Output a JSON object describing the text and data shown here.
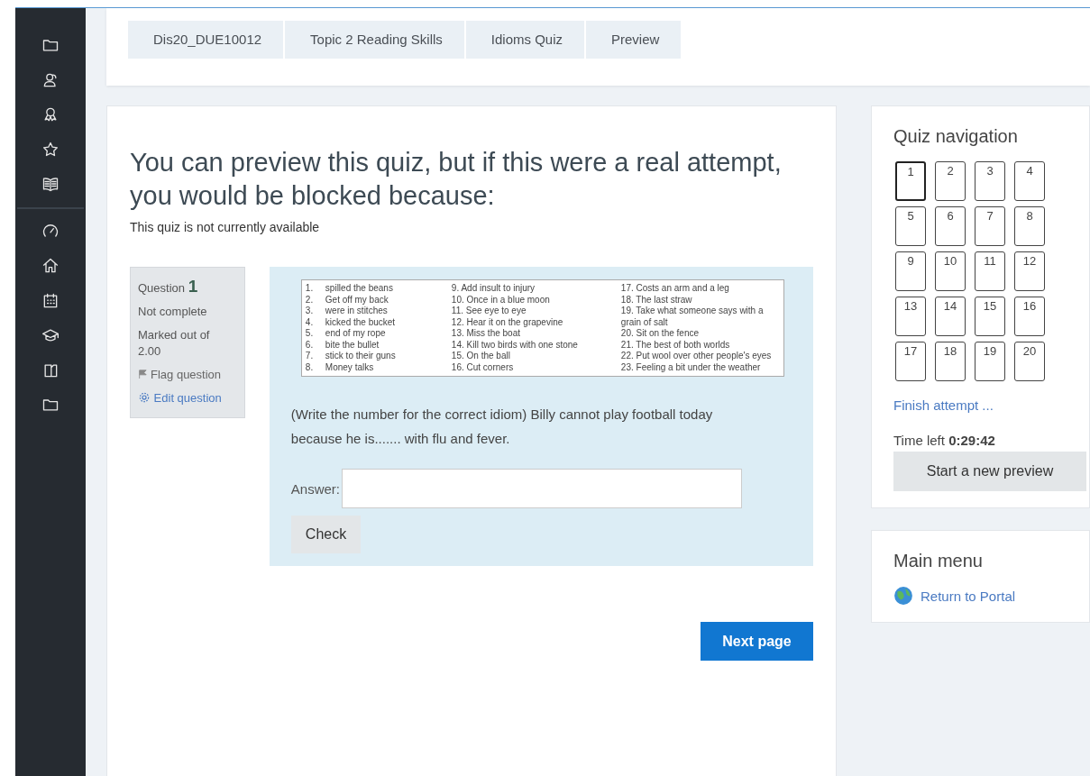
{
  "sidebar": {
    "top_items": [
      {
        "kind": "folder"
      },
      {
        "kind": "users"
      },
      {
        "kind": "award"
      },
      {
        "kind": "star"
      },
      {
        "kind": "book"
      }
    ],
    "bottom_items": [
      {
        "kind": "gauge"
      },
      {
        "kind": "home"
      },
      {
        "kind": "calendar"
      },
      {
        "kind": "graduation"
      },
      {
        "kind": "files"
      },
      {
        "kind": "folder"
      }
    ]
  },
  "breadcrumb": [
    "Dis20_DUE10012",
    "Topic 2 Reading Skills",
    "Idioms Quiz",
    "Preview"
  ],
  "notice": {
    "heading": "You can preview this quiz, but if this were a real attempt, you would be blocked because:",
    "reason": "This quiz is not currently available"
  },
  "question_info": {
    "label": "Question",
    "number": "1",
    "state": "Not complete",
    "marks": "Marked out of 2.00",
    "flag": "Flag question",
    "edit": "Edit question"
  },
  "idiom_table": {
    "column_1": [
      {
        "number": "1.",
        "text": "spilled the beans"
      },
      {
        "number": "2.",
        "text": "Get off my back"
      },
      {
        "number": "3.",
        "text": "were in stitches"
      },
      {
        "number": "4.",
        "text": "kicked the bucket"
      },
      {
        "number": "5.",
        "text": "end of my rope"
      },
      {
        "number": "6.",
        "text": "bite the bullet"
      },
      {
        "number": "7.",
        "text": "stick to their guns"
      },
      {
        "number": "8.",
        "text": "Money talks"
      }
    ],
    "column_2": [
      "9. Add insult to injury",
      "10. Once in a blue moon",
      "11. See eye to eye",
      "12. Hear it on the grapevine",
      "13. Miss the boat",
      "14. Kill two birds with one stone",
      "15. On the ball",
      "16. Cut corners"
    ],
    "column_3": [
      "17. Costs an arm and a leg",
      "18. The last straw",
      "19. Take what someone says with a grain of salt",
      "20. Sit on the fence",
      "21. The best of both worlds",
      "22. Put wool over other people's eyes",
      "23. Feeling a bit under the weather"
    ]
  },
  "question_text": "(Write the number for the correct idiom) Billy cannot play football today because he is....... with flu and fever.",
  "answer": {
    "label": "Answer:"
  },
  "check_button": "Check",
  "next_button": "Next page",
  "quiz_navigation": {
    "title": "Quiz navigation",
    "buttons": [
      {
        "label": "1",
        "selected": true
      },
      {
        "label": "2",
        "selected": false
      },
      {
        "label": "3",
        "selected": false
      },
      {
        "label": "4",
        "selected": false
      },
      {
        "label": "5",
        "selected": false
      },
      {
        "label": "6",
        "selected": false
      },
      {
        "label": "7",
        "selected": false
      },
      {
        "label": "8",
        "selected": false
      },
      {
        "label": "9",
        "selected": false
      },
      {
        "label": "10",
        "selected": false
      },
      {
        "label": "11",
        "selected": false
      },
      {
        "label": "12",
        "selected": false
      },
      {
        "label": "13",
        "selected": false
      },
      {
        "label": "14",
        "selected": false
      },
      {
        "label": "15",
        "selected": false
      },
      {
        "label": "16",
        "selected": false
      },
      {
        "label": "17",
        "selected": false
      },
      {
        "label": "18",
        "selected": false
      },
      {
        "label": "19",
        "selected": false
      },
      {
        "label": "20",
        "selected": false
      }
    ],
    "finish_link": "Finish attempt ...",
    "time_label": "Time left",
    "time_value": "0:29:42",
    "new_preview_button": "Start a new preview"
  },
  "main_menu": {
    "title": "Main menu",
    "link": "Return to Portal"
  }
}
